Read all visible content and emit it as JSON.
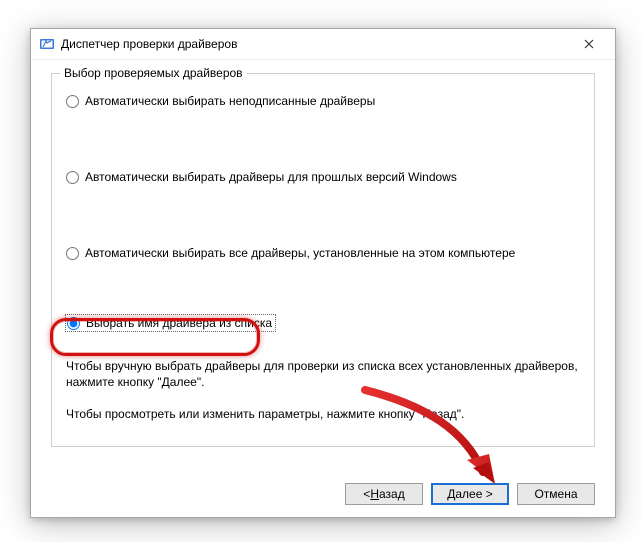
{
  "window": {
    "title": "Диспетчер проверки драйверов"
  },
  "group": {
    "legend": "Выбор проверяемых драйверов",
    "options": {
      "unsigned": "Автоматически выбирать неподписанные драйверы",
      "old_windows": "Автоматически выбирать драйверы для прошлых версий Windows",
      "all_installed": "Автоматически выбирать все драйверы, установленные на этом компьютере",
      "from_list": "Выбрать имя драйвера из списка"
    },
    "help_line1": "Чтобы вручную выбрать драйверы для проверки из списка всех установленных драйверов, нажмите кнопку \"Далее\".",
    "help_line2": "Чтобы просмотреть или изменить параметры, нажмите кнопку \"Назад\"."
  },
  "buttons": {
    "back_prefix": "< ",
    "back_u": "Н",
    "back_rest": "азад",
    "next_u": "Д",
    "next_rest": "алее >",
    "cancel": "Отмена"
  }
}
